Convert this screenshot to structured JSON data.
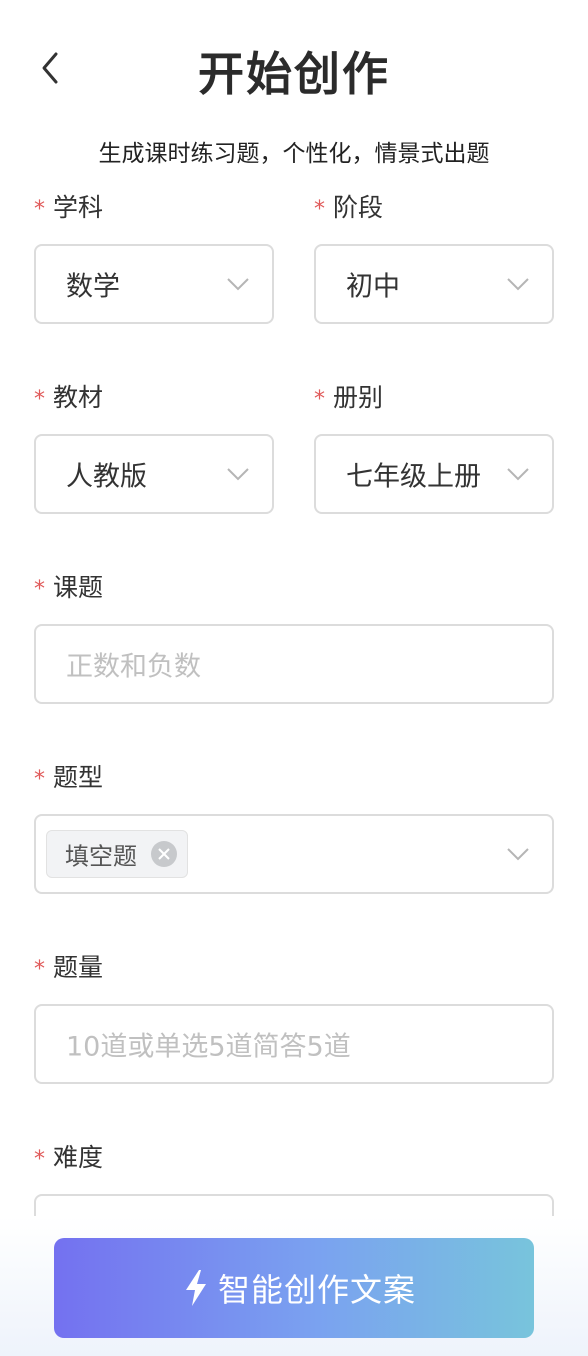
{
  "header": {
    "title": "开始创作",
    "subtitle": "生成课时练习题，个性化，情景式出题"
  },
  "form": {
    "required_mark": "*",
    "subject": {
      "label": "学科",
      "value": "数学"
    },
    "stage": {
      "label": "阶段",
      "value": "初中"
    },
    "textbook": {
      "label": "教材",
      "value": "人教版"
    },
    "volume": {
      "label": "册别",
      "value": "七年级上册"
    },
    "topic": {
      "label": "课题",
      "placeholder": "正数和负数"
    },
    "question_type": {
      "label": "题型",
      "tags": [
        "填空题"
      ]
    },
    "question_count": {
      "label": "题量",
      "placeholder": "10道或单选5道简答5道"
    },
    "difficulty": {
      "label": "难度"
    }
  },
  "cta": {
    "label": "智能创作文案",
    "icon": "lightning-icon"
  },
  "colors": {
    "required": "#e05a5a",
    "cta_gradient_start": "#7471f0",
    "cta_gradient_end": "#78c4dc",
    "border": "#dcdcdc",
    "placeholder": "#c0c0c0"
  }
}
